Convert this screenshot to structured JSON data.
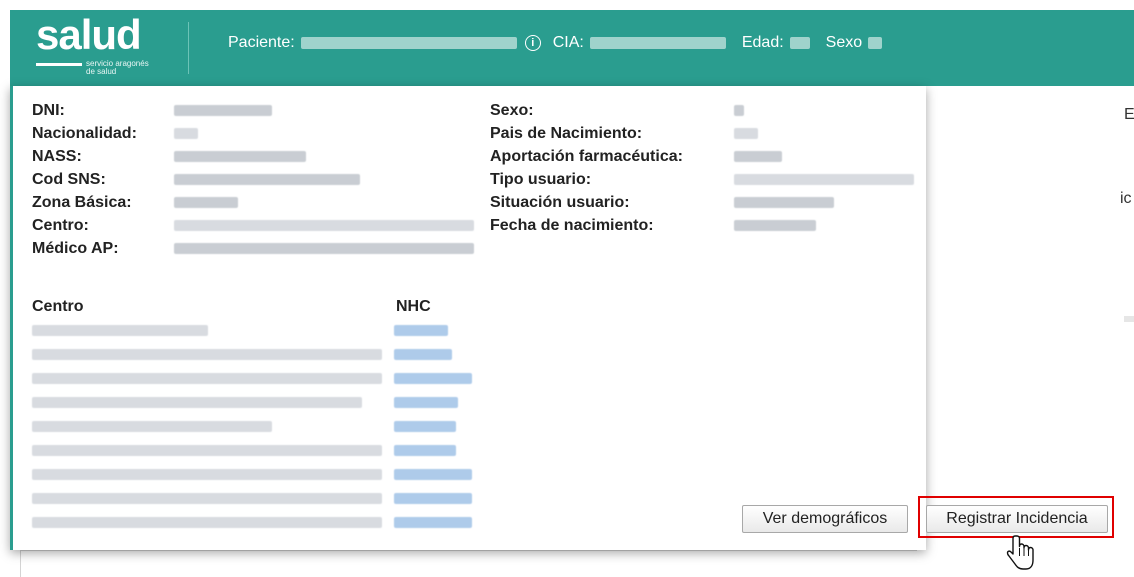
{
  "header": {
    "logo_text": "salud",
    "logo_sub_1": "servicio aragonés",
    "logo_sub_2": "de salud",
    "paciente_label": "Paciente:",
    "cia_label": "CIA:",
    "edad_label": "Edad:",
    "sexo_label": "Sexo",
    "info_glyph": "i"
  },
  "left_fields": [
    {
      "label": "DNI:"
    },
    {
      "label": "Nacionalidad:"
    },
    {
      "label": "NASS:"
    },
    {
      "label": "Cod SNS:"
    },
    {
      "label": "Zona Básica:"
    },
    {
      "label": "Centro:"
    },
    {
      "label": "Médico AP:"
    }
  ],
  "right_fields": [
    {
      "label": "Sexo:"
    },
    {
      "label": "Pais de Nacimiento:"
    },
    {
      "label": "Aportación farmacéutica:"
    },
    {
      "label": "Tipo usuario:"
    },
    {
      "label": "Situación usuario:"
    },
    {
      "label": "Fecha de nacimiento:"
    }
  ],
  "table": {
    "col_centro": "Centro",
    "col_nhc": "NHC"
  },
  "buttons": {
    "ver_demograficos": "Ver demográficos",
    "registrar_incidencia": "Registrar Incidencia"
  },
  "background": {
    "frag_1": "E",
    "frag_2": "ic"
  },
  "colors": {
    "header_bg": "#2a9d8f",
    "highlight": "#e00000"
  }
}
